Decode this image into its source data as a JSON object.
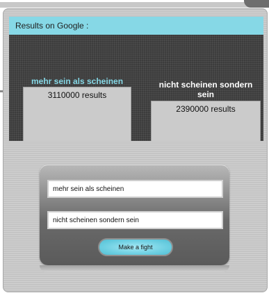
{
  "results": {
    "header": "Results on Google :",
    "items": [
      {
        "query": "mehr sein als scheinen",
        "count_text": "3110000 results"
      },
      {
        "query": "nicht scheinen sondern sein",
        "count_text": "2390000 results"
      }
    ]
  },
  "form": {
    "input1_value": "mehr sein als scheinen",
    "input2_value": "nicht scheinen sondern sein",
    "button_label": "Make a fight"
  },
  "colors": {
    "accent": "#86d8e6",
    "dark_panel": "#3c3c3c",
    "card": "#cbcbcb"
  }
}
